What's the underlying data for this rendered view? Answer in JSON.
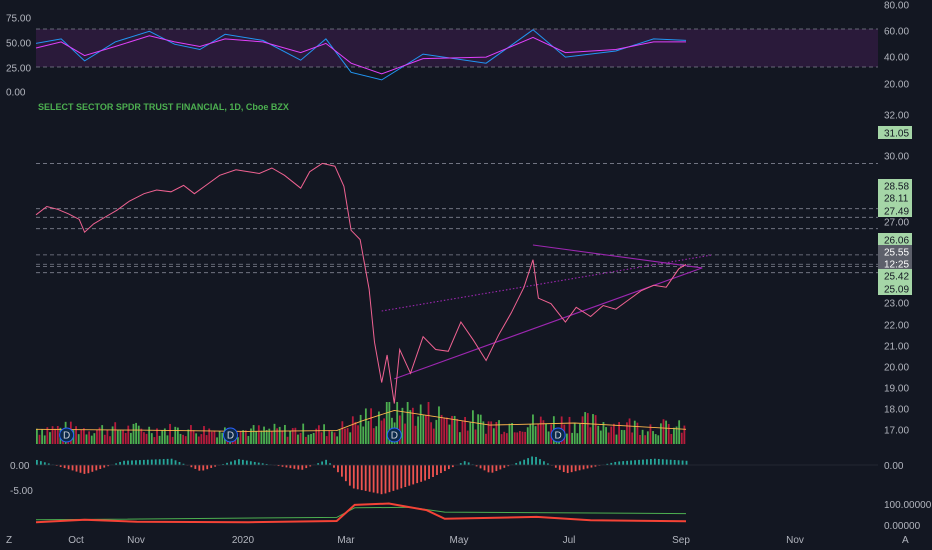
{
  "chart_data": {
    "type": "line",
    "title": "SELECT SECTOR SPDR TRUST FINANCIAL, 1D, Cboe BZX",
    "x_ticks": [
      "Oct",
      "Nov",
      "2020",
      "Mar",
      "May",
      "Jul",
      "Sep",
      "Nov"
    ],
    "price_axis": {
      "ticks": [
        "32.00",
        "31.05",
        "30.00",
        "28.58",
        "28.11",
        "27.49",
        "27.00",
        "26.06",
        "25.55",
        "12:25",
        "25.42",
        "25.09",
        "23.00",
        "22.00",
        "21.00",
        "20.00",
        "19.00",
        "18.00",
        "17.00"
      ],
      "ylim": [
        16.4,
        32.6
      ]
    },
    "price_series": [
      {
        "date": "2019-09-06",
        "close": 28.25
      },
      {
        "date": "2019-09-12",
        "close": 28.7
      },
      {
        "date": "2019-09-18",
        "close": 28.55
      },
      {
        "date": "2019-09-24",
        "close": 28.3
      },
      {
        "date": "2019-09-30",
        "close": 28.0
      },
      {
        "date": "2019-10-03",
        "close": 27.3
      },
      {
        "date": "2019-10-08",
        "close": 27.75
      },
      {
        "date": "2019-10-14",
        "close": 28.1
      },
      {
        "date": "2019-10-21",
        "close": 28.5
      },
      {
        "date": "2019-10-28",
        "close": 29.0
      },
      {
        "date": "2019-11-05",
        "close": 29.4
      },
      {
        "date": "2019-11-12",
        "close": 29.6
      },
      {
        "date": "2019-11-20",
        "close": 29.5
      },
      {
        "date": "2019-11-27",
        "close": 29.85
      },
      {
        "date": "2019-12-03",
        "close": 29.4
      },
      {
        "date": "2019-12-10",
        "close": 29.9
      },
      {
        "date": "2019-12-17",
        "close": 30.4
      },
      {
        "date": "2019-12-26",
        "close": 30.7
      },
      {
        "date": "2020-01-02",
        "close": 30.6
      },
      {
        "date": "2020-01-08",
        "close": 30.5
      },
      {
        "date": "2020-01-15",
        "close": 30.8
      },
      {
        "date": "2020-01-22",
        "close": 30.4
      },
      {
        "date": "2020-01-31",
        "close": 29.7
      },
      {
        "date": "2020-02-05",
        "close": 30.6
      },
      {
        "date": "2020-02-12",
        "close": 31.05
      },
      {
        "date": "2020-02-19",
        "close": 30.9
      },
      {
        "date": "2020-02-24",
        "close": 29.8
      },
      {
        "date": "2020-02-28",
        "close": 27.4
      },
      {
        "date": "2020-03-04",
        "close": 26.9
      },
      {
        "date": "2020-03-09",
        "close": 24.2
      },
      {
        "date": "2020-03-12",
        "close": 21.3
      },
      {
        "date": "2020-03-16",
        "close": 19.1
      },
      {
        "date": "2020-03-19",
        "close": 20.6
      },
      {
        "date": "2020-03-23",
        "close": 17.95
      },
      {
        "date": "2020-03-26",
        "close": 20.9
      },
      {
        "date": "2020-04-01",
        "close": 19.6
      },
      {
        "date": "2020-04-08",
        "close": 21.6
      },
      {
        "date": "2020-04-15",
        "close": 20.9
      },
      {
        "date": "2020-04-22",
        "close": 20.8
      },
      {
        "date": "2020-04-29",
        "close": 22.4
      },
      {
        "date": "2020-05-06",
        "close": 21.4
      },
      {
        "date": "2020-05-13",
        "close": 20.3
      },
      {
        "date": "2020-05-20",
        "close": 21.7
      },
      {
        "date": "2020-05-27",
        "close": 22.9
      },
      {
        "date": "2020-06-03",
        "close": 24.3
      },
      {
        "date": "2020-06-08",
        "close": 25.8
      },
      {
        "date": "2020-06-11",
        "close": 23.7
      },
      {
        "date": "2020-06-18",
        "close": 23.4
      },
      {
        "date": "2020-06-26",
        "close": 22.4
      },
      {
        "date": "2020-07-02",
        "close": 23.2
      },
      {
        "date": "2020-07-10",
        "close": 22.7
      },
      {
        "date": "2020-07-17",
        "close": 23.3
      },
      {
        "date": "2020-07-24",
        "close": 23.1
      },
      {
        "date": "2020-07-31",
        "close": 23.6
      },
      {
        "date": "2020-08-07",
        "close": 24.1
      },
      {
        "date": "2020-08-14",
        "close": 24.4
      },
      {
        "date": "2020-08-21",
        "close": 24.3
      },
      {
        "date": "2020-08-28",
        "close": 25.3
      },
      {
        "date": "2020-09-01",
        "close": 25.55
      }
    ],
    "volume_moving_average": [
      {
        "date": "2019-09-06",
        "value": 0.35
      },
      {
        "date": "2019-11-01",
        "value": 0.33
      },
      {
        "date": "2020-01-02",
        "value": 0.3
      },
      {
        "date": "2020-02-20",
        "value": 0.32
      },
      {
        "date": "2020-03-05",
        "value": 0.55
      },
      {
        "date": "2020-03-23",
        "value": 0.8
      },
      {
        "date": "2020-04-15",
        "value": 0.65
      },
      {
        "date": "2020-05-15",
        "value": 0.45
      },
      {
        "date": "2020-07-01",
        "value": 0.5
      },
      {
        "date": "2020-09-01",
        "value": 0.35
      }
    ],
    "dividend_markers": [
      {
        "date": "2019-09-23",
        "label": "D"
      },
      {
        "date": "2019-12-23",
        "label": "D"
      },
      {
        "date": "2020-03-23",
        "label": "D"
      },
      {
        "date": "2020-06-22",
        "label": "D"
      }
    ],
    "levels": [
      {
        "value": 31.05,
        "label": "31.05",
        "style": "dashed"
      },
      {
        "value": 28.58,
        "label": "28.58",
        "style": "dashed"
      },
      {
        "value": 28.11,
        "label": "28.11",
        "style": "dashed"
      },
      {
        "value": 27.49,
        "label": "27.49",
        "style": "dashed"
      },
      {
        "value": 26.06,
        "label": "26.06",
        "style": "dashed"
      },
      {
        "value": 25.55,
        "label": "25.55",
        "style": "dashed"
      },
      {
        "value": 25.42,
        "label": "25.42",
        "style": "dashed"
      },
      {
        "value": 25.09,
        "label": "25.09",
        "style": "dashed"
      }
    ],
    "trendlines": [
      {
        "from": {
          "date": "2020-06-08",
          "value": 26.6
        },
        "to": {
          "date": "2020-09-10",
          "value": 25.35
        },
        "color": "#9c27b0",
        "style": "solid"
      },
      {
        "from": {
          "date": "2020-03-23",
          "value": 19.3
        },
        "to": {
          "date": "2020-09-10",
          "value": 25.35
        },
        "color": "#9c27b0",
        "style": "solid"
      },
      {
        "from": {
          "date": "2020-03-16",
          "value": 23.0
        },
        "to": {
          "date": "2020-09-15",
          "value": 26.05
        },
        "color": "#9c27b0",
        "style": "dotted"
      }
    ],
    "rsi_panel": {
      "left_ticks": [
        "75.00",
        "50.00",
        "25.00",
        "0.00"
      ],
      "right_ticks": [
        "80.00",
        "60.00",
        "40.00",
        "20.00"
      ],
      "band": [
        25,
        75
      ],
      "series_a": [
        {
          "date": "2019-09-06",
          "value": 56
        },
        {
          "date": "2019-09-20",
          "value": 62
        },
        {
          "date": "2019-10-03",
          "value": 33
        },
        {
          "date": "2019-10-20",
          "value": 58
        },
        {
          "date": "2019-11-08",
          "value": 72
        },
        {
          "date": "2019-11-22",
          "value": 55
        },
        {
          "date": "2019-12-06",
          "value": 48
        },
        {
          "date": "2019-12-20",
          "value": 68
        },
        {
          "date": "2020-01-10",
          "value": 60
        },
        {
          "date": "2020-01-31",
          "value": 34
        },
        {
          "date": "2020-02-14",
          "value": 62
        },
        {
          "date": "2020-02-28",
          "value": 18
        },
        {
          "date": "2020-03-16",
          "value": 8
        },
        {
          "date": "2020-04-08",
          "value": 42
        },
        {
          "date": "2020-05-13",
          "value": 30
        },
        {
          "date": "2020-06-08",
          "value": 74
        },
        {
          "date": "2020-06-26",
          "value": 38
        },
        {
          "date": "2020-07-24",
          "value": 46
        },
        {
          "date": "2020-08-14",
          "value": 62
        },
        {
          "date": "2020-09-01",
          "value": 60
        }
      ],
      "series_b": [
        {
          "date": "2019-09-06",
          "value": 50
        },
        {
          "date": "2019-09-20",
          "value": 58
        },
        {
          "date": "2019-10-03",
          "value": 40
        },
        {
          "date": "2019-10-20",
          "value": 52
        },
        {
          "date": "2019-11-08",
          "value": 66
        },
        {
          "date": "2019-11-22",
          "value": 58
        },
        {
          "date": "2019-12-06",
          "value": 52
        },
        {
          "date": "2019-12-20",
          "value": 62
        },
        {
          "date": "2020-01-10",
          "value": 58
        },
        {
          "date": "2020-01-31",
          "value": 44
        },
        {
          "date": "2020-02-14",
          "value": 56
        },
        {
          "date": "2020-02-28",
          "value": 30
        },
        {
          "date": "2020-03-16",
          "value": 16
        },
        {
          "date": "2020-04-08",
          "value": 36
        },
        {
          "date": "2020-05-13",
          "value": 38
        },
        {
          "date": "2020-06-08",
          "value": 64
        },
        {
          "date": "2020-06-26",
          "value": 44
        },
        {
          "date": "2020-07-24",
          "value": 48
        },
        {
          "date": "2020-08-14",
          "value": 58
        },
        {
          "date": "2020-09-01",
          "value": 58
        }
      ]
    },
    "oscillator_panel": {
      "ticks": [
        "0.00",
        "-5.00"
      ],
      "right_ticks": [
        "0.00"
      ],
      "histogram": [
        {
          "date": "2019-09-06",
          "value": 1.2
        },
        {
          "date": "2019-10-03",
          "value": -2.2
        },
        {
          "date": "2019-10-24",
          "value": 1.0
        },
        {
          "date": "2019-11-20",
          "value": 1.5
        },
        {
          "date": "2019-12-06",
          "value": -1.5
        },
        {
          "date": "2019-12-27",
          "value": 1.4
        },
        {
          "date": "2020-01-31",
          "value": -1.2
        },
        {
          "date": "2020-02-14",
          "value": 1.3
        },
        {
          "date": "2020-02-28",
          "value": -5.5
        },
        {
          "date": "2020-03-16",
          "value": -7.0
        },
        {
          "date": "2020-04-10",
          "value": -3.5
        },
        {
          "date": "2020-05-01",
          "value": 1.0
        },
        {
          "date": "2020-05-15",
          "value": -2.0
        },
        {
          "date": "2020-06-08",
          "value": 2.2
        },
        {
          "date": "2020-06-26",
          "value": -2.0
        },
        {
          "date": "2020-07-24",
          "value": 0.8
        },
        {
          "date": "2020-08-14",
          "value": 1.5
        },
        {
          "date": "2020-09-01",
          "value": 1.0
        }
      ]
    },
    "bottom_panel": {
      "right_ticks": [
        "100.00000",
        "0.00000"
      ],
      "upper_series": [
        {
          "date": "2019-09-06",
          "value": 30
        },
        {
          "date": "2020-02-20",
          "value": 40
        },
        {
          "date": "2020-03-01",
          "value": 80
        },
        {
          "date": "2020-04-01",
          "value": 82
        },
        {
          "date": "2020-04-20",
          "value": 62
        },
        {
          "date": "2020-09-01",
          "value": 56
        }
      ],
      "lower_series": [
        {
          "date": "2019-09-06",
          "value": 20
        },
        {
          "date": "2019-10-03",
          "value": 30
        },
        {
          "date": "2019-11-01",
          "value": 22
        },
        {
          "date": "2020-01-02",
          "value": 20
        },
        {
          "date": "2020-02-20",
          "value": 25
        },
        {
          "date": "2020-03-01",
          "value": 92
        },
        {
          "date": "2020-03-20",
          "value": 98
        },
        {
          "date": "2020-04-10",
          "value": 70
        },
        {
          "date": "2020-04-20",
          "value": 34
        },
        {
          "date": "2020-06-10",
          "value": 42
        },
        {
          "date": "2020-07-10",
          "value": 28
        },
        {
          "date": "2020-09-01",
          "value": 24
        }
      ]
    },
    "corner_labels": {
      "left": "Z",
      "right": "A"
    }
  },
  "colors": {
    "background": "#131722",
    "price": "#f06292",
    "grid_dashed": "#7f8290",
    "rsi_a": "#2196f3",
    "rsi_b": "#e040fb",
    "rsi_c": "#ffb74d",
    "band_fill": "#2a1a3a",
    "vol_up": "#4caf50",
    "vol_down": "#b71c3c",
    "trend": "#9c27b0",
    "hist_pos": "#26a69a",
    "hist_neg": "#ef5350",
    "bottom_upper": "#4caf50",
    "bottom_lower": "#f44336",
    "tag_green": "#a5d6a7",
    "tag_gray": "#5d606b",
    "title": "#4caf50"
  }
}
